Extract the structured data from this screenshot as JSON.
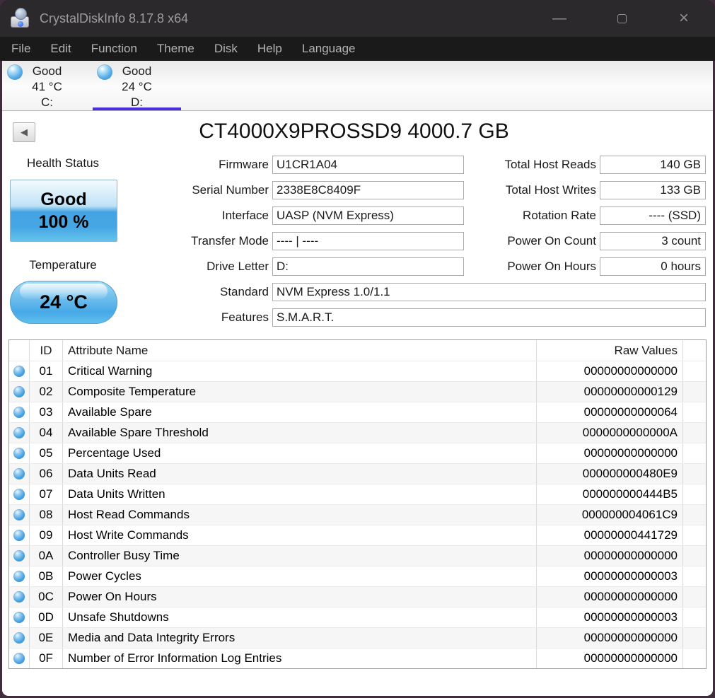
{
  "colors": {
    "accent": "#4b2ed8",
    "status_blue": "#44a3e6",
    "frame": "#402d3b",
    "titlebar_bg": "#2b292b",
    "menubar_bg": "#1b1a1b"
  },
  "window": {
    "title": "CrystalDiskInfo 8.17.8 x64",
    "controls": {
      "minimize": "—",
      "maximize": "maximize",
      "close": "×"
    }
  },
  "menu": {
    "items": [
      {
        "label": "File"
      },
      {
        "label": "Edit"
      },
      {
        "label": "Function"
      },
      {
        "label": "Theme"
      },
      {
        "label": "Disk"
      },
      {
        "label": "Help"
      },
      {
        "label": "Language"
      }
    ]
  },
  "tabs": [
    {
      "status": "Good",
      "temp": "41 °C",
      "drive": "C:",
      "selected": false
    },
    {
      "status": "Good",
      "temp": "24 °C",
      "drive": "D:",
      "selected": true
    }
  ],
  "back_button": {
    "glyph": "◀"
  },
  "drive": {
    "title": "CT4000X9PROSSD9 4000.7 GB"
  },
  "health": {
    "label": "Health Status",
    "status": "Good",
    "percent": "100 %"
  },
  "temperature": {
    "label": "Temperature",
    "value": "24 °C"
  },
  "fields_left": [
    {
      "label": "Firmware",
      "value": "U1CR1A04"
    },
    {
      "label": "Serial Number",
      "value": "2338E8C8409F"
    },
    {
      "label": "Interface",
      "value": "UASP (NVM Express)"
    },
    {
      "label": "Transfer Mode",
      "value": "---- | ----"
    },
    {
      "label": "Drive Letter",
      "value": "D:"
    }
  ],
  "fields_wide": [
    {
      "label": "Standard",
      "value": "NVM Express 1.0/1.1"
    },
    {
      "label": "Features",
      "value": "S.M.A.R.T."
    }
  ],
  "fields_right": [
    {
      "label": "Total Host Reads",
      "value": "140 GB"
    },
    {
      "label": "Total Host Writes",
      "value": "133 GB"
    },
    {
      "label": "Rotation Rate",
      "value": "---- (SSD)"
    },
    {
      "label": "Power On Count",
      "value": "3 count"
    },
    {
      "label": "Power On Hours",
      "value": "0 hours"
    }
  ],
  "smart": {
    "headers": {
      "id": "ID",
      "name": "Attribute Name",
      "raw": "Raw Values"
    },
    "rows": [
      {
        "id": "01",
        "name": "Critical Warning",
        "raw": "00000000000000"
      },
      {
        "id": "02",
        "name": "Composite Temperature",
        "raw": "00000000000129"
      },
      {
        "id": "03",
        "name": "Available Spare",
        "raw": "00000000000064"
      },
      {
        "id": "04",
        "name": "Available Spare Threshold",
        "raw": "0000000000000A"
      },
      {
        "id": "05",
        "name": "Percentage Used",
        "raw": "00000000000000"
      },
      {
        "id": "06",
        "name": "Data Units Read",
        "raw": "000000000480E9"
      },
      {
        "id": "07",
        "name": "Data Units Written",
        "raw": "000000000444B5"
      },
      {
        "id": "08",
        "name": "Host Read Commands",
        "raw": "000000004061C9"
      },
      {
        "id": "09",
        "name": "Host Write Commands",
        "raw": "00000000441729"
      },
      {
        "id": "0A",
        "name": "Controller Busy Time",
        "raw": "00000000000000"
      },
      {
        "id": "0B",
        "name": "Power Cycles",
        "raw": "00000000000003"
      },
      {
        "id": "0C",
        "name": "Power On Hours",
        "raw": "00000000000000"
      },
      {
        "id": "0D",
        "name": "Unsafe Shutdowns",
        "raw": "00000000000003"
      },
      {
        "id": "0E",
        "name": "Media and Data Integrity Errors",
        "raw": "00000000000000"
      },
      {
        "id": "0F",
        "name": "Number of Error Information Log Entries",
        "raw": "00000000000000"
      }
    ]
  }
}
